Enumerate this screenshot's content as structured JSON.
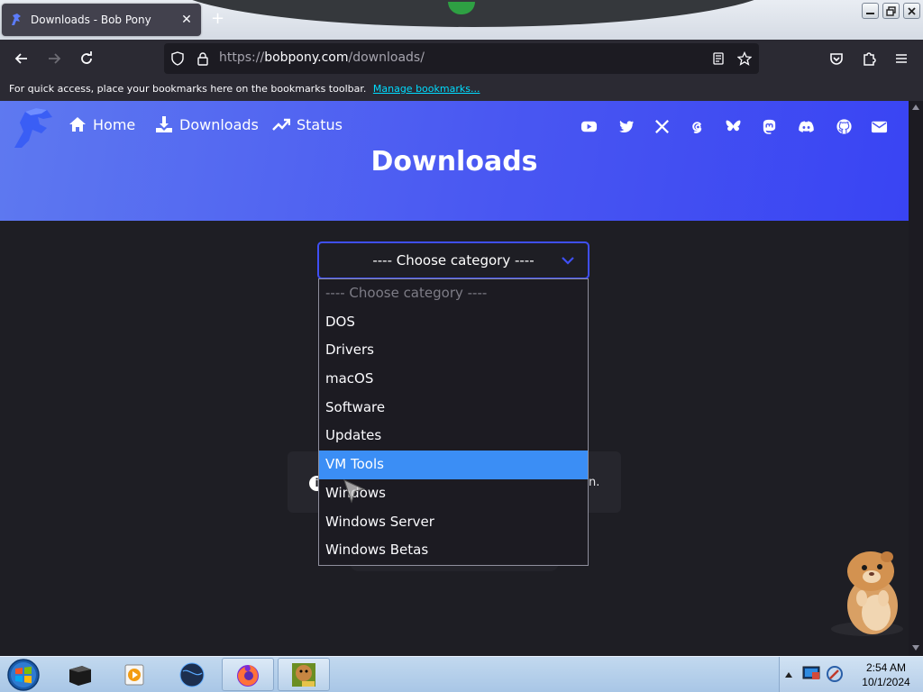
{
  "browser": {
    "tab_title": "Downloads - Bob Pony",
    "tab_close": "✕",
    "new_tab": "+",
    "url": {
      "scheme": "https://",
      "host": "bobpony.com",
      "path": "/downloads/"
    },
    "bookmarks_message": "For quick access, place your bookmarks here on the bookmarks toolbar.",
    "manage_bookmarks": "Manage bookmarks..."
  },
  "site": {
    "nav": [
      {
        "label": "Home",
        "icon": "home-icon"
      },
      {
        "label": "Downloads",
        "icon": "download-icon"
      },
      {
        "label": "Status",
        "icon": "trending-up-icon"
      }
    ],
    "social_icons": [
      "youtube-icon",
      "twitter-icon",
      "x-icon",
      "threads-icon",
      "bluesky-icon",
      "mastodon-icon",
      "discord-icon",
      "github-icon",
      "mail-icon"
    ],
    "page_title": "Downloads",
    "accent": "#3f4ff5"
  },
  "category_select": {
    "value": "---- Choose category ----",
    "options": [
      "---- Choose category ----",
      "DOS",
      "Drivers",
      "macOS",
      "Software",
      "Updates",
      "VM Tools",
      "Windows",
      "Windows Server",
      "Windows Betas"
    ],
    "highlighted": "VM Tools"
  },
  "info_card": {
    "icon": "i",
    "visible_tail": "n."
  },
  "taskbar": {
    "time": "2:54 AM",
    "date": "10/1/2024"
  }
}
